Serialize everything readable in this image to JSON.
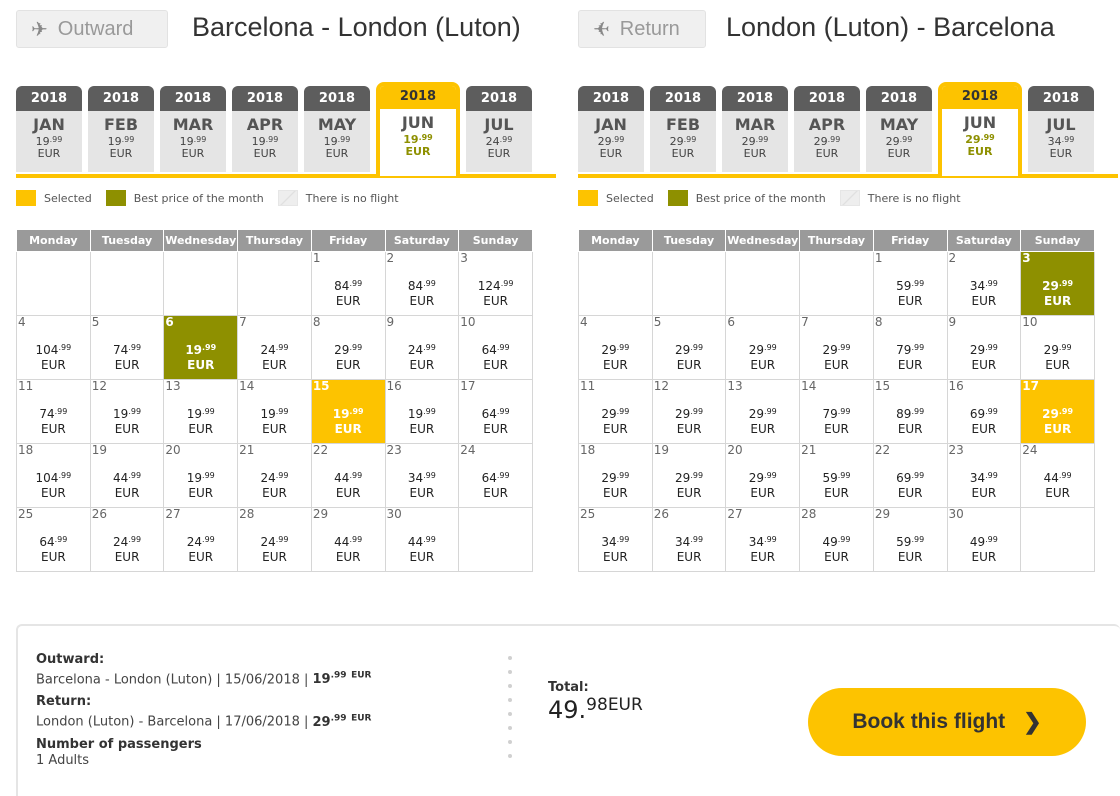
{
  "outward": {
    "button": "Outward",
    "title": "Barcelona - London (Luton)",
    "months": [
      {
        "year": "2018",
        "name": "JAN",
        "price": "19",
        "cents": ".99",
        "cur": "EUR",
        "selected": false
      },
      {
        "year": "2018",
        "name": "FEB",
        "price": "19",
        "cents": ".99",
        "cur": "EUR",
        "selected": false
      },
      {
        "year": "2018",
        "name": "MAR",
        "price": "19",
        "cents": ".99",
        "cur": "EUR",
        "selected": false
      },
      {
        "year": "2018",
        "name": "APR",
        "price": "19",
        "cents": ".99",
        "cur": "EUR",
        "selected": false
      },
      {
        "year": "2018",
        "name": "MAY",
        "price": "19",
        "cents": ".99",
        "cur": "EUR",
        "selected": false
      },
      {
        "year": "2018",
        "name": "JUN",
        "price": "19",
        "cents": ".99",
        "cur": "EUR",
        "selected": true
      },
      {
        "year": "2018",
        "name": "JUL",
        "price": "24",
        "cents": ".99",
        "cur": "EUR",
        "selected": false
      }
    ],
    "weeks": [
      [
        null,
        null,
        null,
        null,
        {
          "d": "1",
          "p": "84",
          "c": ".99"
        },
        {
          "d": "2",
          "p": "84",
          "c": ".99"
        },
        {
          "d": "3",
          "p": "124",
          "c": ".99"
        }
      ],
      [
        {
          "d": "4",
          "p": "104",
          "c": ".99"
        },
        {
          "d": "5",
          "p": "74",
          "c": ".99"
        },
        {
          "d": "6",
          "p": "19",
          "c": ".99",
          "state": "best"
        },
        {
          "d": "7",
          "p": "24",
          "c": ".99"
        },
        {
          "d": "8",
          "p": "29",
          "c": ".99"
        },
        {
          "d": "9",
          "p": "24",
          "c": ".99"
        },
        {
          "d": "10",
          "p": "64",
          "c": ".99"
        }
      ],
      [
        {
          "d": "11",
          "p": "74",
          "c": ".99"
        },
        {
          "d": "12",
          "p": "19",
          "c": ".99"
        },
        {
          "d": "13",
          "p": "19",
          "c": ".99"
        },
        {
          "d": "14",
          "p": "19",
          "c": ".99"
        },
        {
          "d": "15",
          "p": "19",
          "c": ".99",
          "state": "selected"
        },
        {
          "d": "16",
          "p": "19",
          "c": ".99"
        },
        {
          "d": "17",
          "p": "64",
          "c": ".99"
        }
      ],
      [
        {
          "d": "18",
          "p": "104",
          "c": ".99"
        },
        {
          "d": "19",
          "p": "44",
          "c": ".99"
        },
        {
          "d": "20",
          "p": "19",
          "c": ".99"
        },
        {
          "d": "21",
          "p": "24",
          "c": ".99"
        },
        {
          "d": "22",
          "p": "44",
          "c": ".99"
        },
        {
          "d": "23",
          "p": "34",
          "c": ".99"
        },
        {
          "d": "24",
          "p": "64",
          "c": ".99"
        }
      ],
      [
        {
          "d": "25",
          "p": "64",
          "c": ".99"
        },
        {
          "d": "26",
          "p": "24",
          "c": ".99"
        },
        {
          "d": "27",
          "p": "24",
          "c": ".99"
        },
        {
          "d": "28",
          "p": "24",
          "c": ".99"
        },
        {
          "d": "29",
          "p": "44",
          "c": ".99"
        },
        {
          "d": "30",
          "p": "44",
          "c": ".99"
        },
        null
      ]
    ]
  },
  "return": {
    "button": "Return",
    "title": "London (Luton) - Barcelona",
    "months": [
      {
        "year": "2018",
        "name": "JAN",
        "price": "29",
        "cents": ".99",
        "cur": "EUR",
        "selected": false
      },
      {
        "year": "2018",
        "name": "FEB",
        "price": "29",
        "cents": ".99",
        "cur": "EUR",
        "selected": false
      },
      {
        "year": "2018",
        "name": "MAR",
        "price": "29",
        "cents": ".99",
        "cur": "EUR",
        "selected": false
      },
      {
        "year": "2018",
        "name": "APR",
        "price": "29",
        "cents": ".99",
        "cur": "EUR",
        "selected": false
      },
      {
        "year": "2018",
        "name": "MAY",
        "price": "29",
        "cents": ".99",
        "cur": "EUR",
        "selected": false
      },
      {
        "year": "2018",
        "name": "JUN",
        "price": "29",
        "cents": ".99",
        "cur": "EUR",
        "selected": true
      },
      {
        "year": "2018",
        "name": "JUL",
        "price": "34",
        "cents": ".99",
        "cur": "EUR",
        "selected": false
      }
    ],
    "weeks": [
      [
        null,
        null,
        null,
        null,
        {
          "d": "1",
          "p": "59",
          "c": ".99"
        },
        {
          "d": "2",
          "p": "34",
          "c": ".99"
        },
        {
          "d": "3",
          "p": "29",
          "c": ".99",
          "state": "best"
        }
      ],
      [
        {
          "d": "4",
          "p": "29",
          "c": ".99"
        },
        {
          "d": "5",
          "p": "29",
          "c": ".99"
        },
        {
          "d": "6",
          "p": "29",
          "c": ".99"
        },
        {
          "d": "7",
          "p": "29",
          "c": ".99"
        },
        {
          "d": "8",
          "p": "79",
          "c": ".99"
        },
        {
          "d": "9",
          "p": "29",
          "c": ".99"
        },
        {
          "d": "10",
          "p": "29",
          "c": ".99"
        }
      ],
      [
        {
          "d": "11",
          "p": "29",
          "c": ".99"
        },
        {
          "d": "12",
          "p": "29",
          "c": ".99"
        },
        {
          "d": "13",
          "p": "29",
          "c": ".99"
        },
        {
          "d": "14",
          "p": "79",
          "c": ".99"
        },
        {
          "d": "15",
          "p": "89",
          "c": ".99"
        },
        {
          "d": "16",
          "p": "69",
          "c": ".99"
        },
        {
          "d": "17",
          "p": "29",
          "c": ".99",
          "state": "selected"
        }
      ],
      [
        {
          "d": "18",
          "p": "29",
          "c": ".99"
        },
        {
          "d": "19",
          "p": "29",
          "c": ".99"
        },
        {
          "d": "20",
          "p": "29",
          "c": ".99"
        },
        {
          "d": "21",
          "p": "59",
          "c": ".99"
        },
        {
          "d": "22",
          "p": "69",
          "c": ".99"
        },
        {
          "d": "23",
          "p": "34",
          "c": ".99"
        },
        {
          "d": "24",
          "p": "44",
          "c": ".99"
        }
      ],
      [
        {
          "d": "25",
          "p": "34",
          "c": ".99"
        },
        {
          "d": "26",
          "p": "34",
          "c": ".99"
        },
        {
          "d": "27",
          "p": "34",
          "c": ".99"
        },
        {
          "d": "28",
          "p": "49",
          "c": ".99"
        },
        {
          "d": "29",
          "p": "59",
          "c": ".99"
        },
        {
          "d": "30",
          "p": "49",
          "c": ".99"
        },
        null
      ]
    ]
  },
  "currency": "EUR",
  "legend": {
    "selected": "Selected",
    "best": "Best price of the month",
    "none": "There is no flight"
  },
  "weekdays": [
    "Monday",
    "Tuesday",
    "Wednesday",
    "Thursday",
    "Friday",
    "Saturday",
    "Sunday"
  ],
  "summary": {
    "outward_label": "Outward:",
    "outward_route": "Barcelona - London (Luton) |  15/06/2018 | ",
    "outward_price": "19",
    "outward_cents": ".99",
    "return_label": "Return:",
    "return_route": "London (Luton) - Barcelona |  17/06/2018 | ",
    "return_price": "29",
    "return_cents": ".99",
    "passengers_label": "Number of passengers",
    "passengers_value": "1 Adults",
    "total_label": "Total:",
    "total_int": "49.",
    "total_cents": "98",
    "total_cur": "EUR",
    "book_label": "Book this flight"
  },
  "colors": {
    "accent": "#fdc300",
    "best": "#8e9000",
    "header_gray": "#5d5d5d"
  },
  "icons": {
    "outward": "plane-right-icon",
    "return": "plane-left-icon",
    "book": "chevron-right-icon"
  }
}
